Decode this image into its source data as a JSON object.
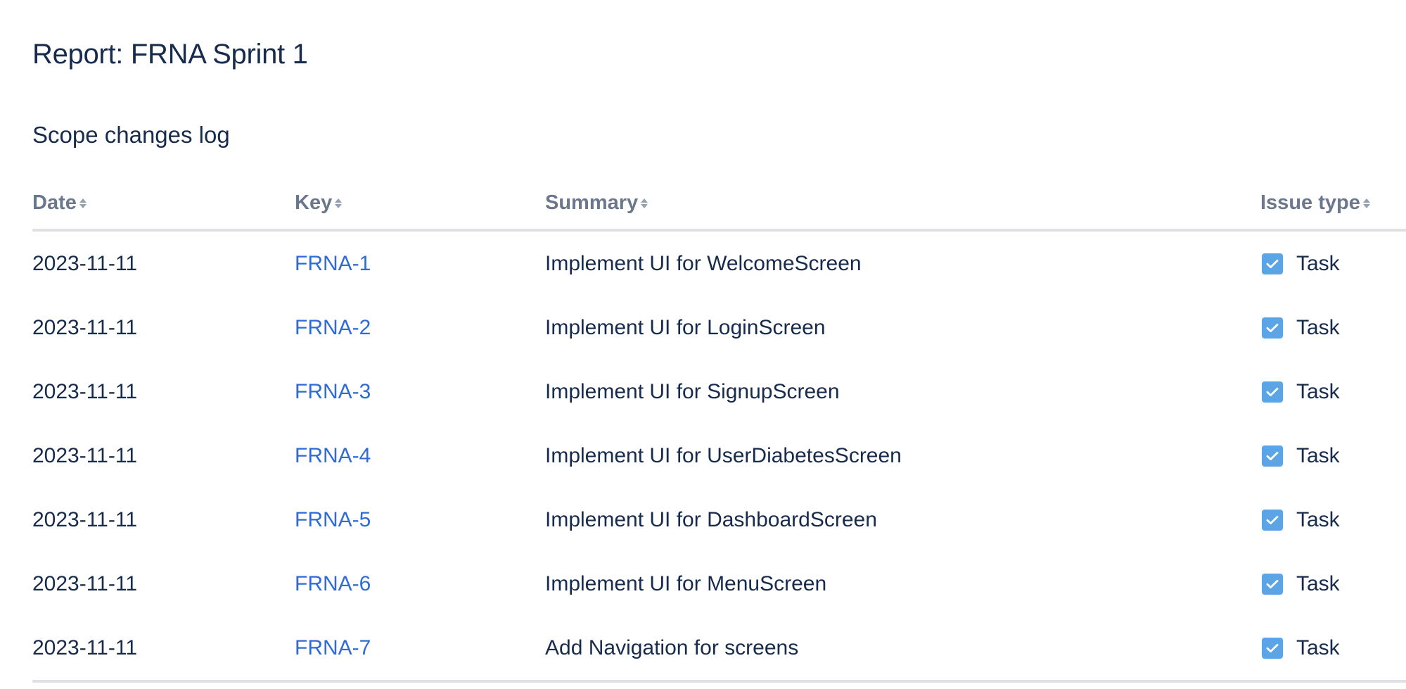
{
  "report": {
    "title": "Report: FRNA Sprint 1"
  },
  "section": {
    "title": "Scope changes log"
  },
  "table": {
    "columns": [
      {
        "label": "Date"
      },
      {
        "label": "Key"
      },
      {
        "label": "Summary"
      },
      {
        "label": "Issue type"
      }
    ],
    "rows": [
      {
        "date": "2023-11-11",
        "key": "FRNA-1",
        "summary": "Implement UI for WelcomeScreen",
        "issue_type": "Task"
      },
      {
        "date": "2023-11-11",
        "key": "FRNA-2",
        "summary": "Implement UI for LoginScreen",
        "issue_type": "Task"
      },
      {
        "date": "2023-11-11",
        "key": "FRNA-3",
        "summary": "Implement UI for SignupScreen",
        "issue_type": "Task"
      },
      {
        "date": "2023-11-11",
        "key": "FRNA-4",
        "summary": "Implement UI for UserDiabetesScreen",
        "issue_type": "Task"
      },
      {
        "date": "2023-11-11",
        "key": "FRNA-5",
        "summary": "Implement UI for DashboardScreen",
        "issue_type": "Task"
      },
      {
        "date": "2023-11-11",
        "key": "FRNA-6",
        "summary": "Implement UI for MenuScreen",
        "issue_type": "Task"
      },
      {
        "date": "2023-11-11",
        "key": "FRNA-7",
        "summary": "Add Navigation for screens",
        "issue_type": "Task"
      }
    ]
  },
  "icons": {
    "sort": "sort-icon",
    "task": "task-checkbox-icon"
  },
  "colors": {
    "heading": "#172b4d",
    "column_header": "#6b778c",
    "link": "#2f6bd6",
    "task_icon": "#5ba4e6",
    "divider": "#dfe1e6"
  }
}
